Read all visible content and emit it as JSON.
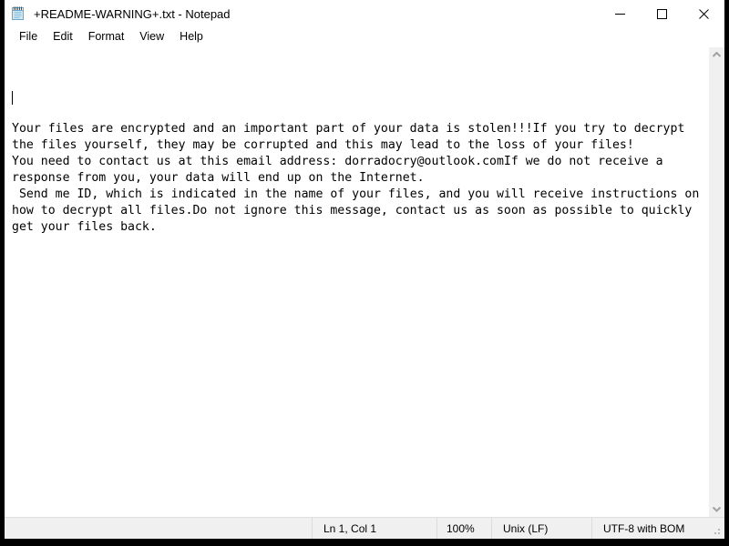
{
  "window": {
    "title": "+README-WARNING+.txt - Notepad",
    "app_icon": "notepad-icon",
    "controls": {
      "minimize": "Minimize",
      "maximize": "Maximize",
      "close": "Close"
    }
  },
  "menu": {
    "items": [
      {
        "label": "File"
      },
      {
        "label": "Edit"
      },
      {
        "label": "Format"
      },
      {
        "label": "View"
      },
      {
        "label": "Help"
      }
    ]
  },
  "editor": {
    "content": "\nYour files are encrypted and an important part of your data is stolen!!!If you try to decrypt the files yourself, they may be corrupted and this may lead to the loss of your files!\nYou need to contact us at this email address: dorradocry@outlook.comIf we do not receive a response from you, your data will end up on the Internet.\n Send me ID, which is indicated in the name of your files, and you will receive instructions on how to decrypt all files.Do not ignore this message, contact us as soon as possible to quickly get your files back.",
    "caret_visible": true
  },
  "scrollbar": {
    "up_arrow": "chevron-up-icon",
    "down_arrow": "chevron-down-icon"
  },
  "status_bar": {
    "line_col": "Ln 1, Col 1",
    "zoom": "100%",
    "line_ending": "Unix (LF)",
    "encoding": "UTF-8 with BOM"
  },
  "colors": {
    "window_bg": "#ffffff",
    "chrome_bg": "#f0f0f0",
    "text": "#000000",
    "border": "#dcdcdc",
    "desktop": "#000000"
  }
}
